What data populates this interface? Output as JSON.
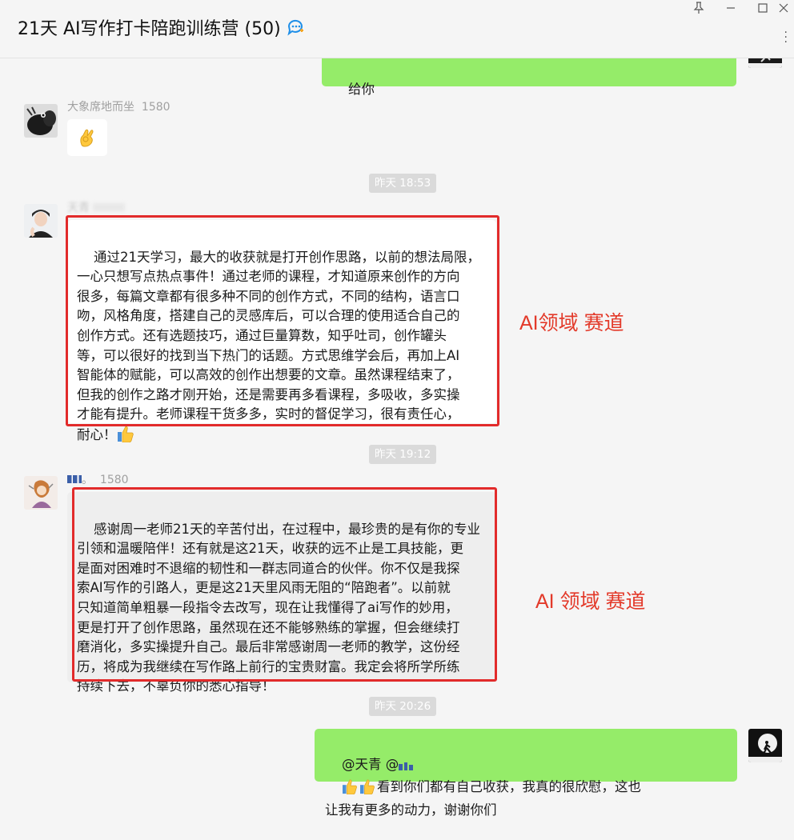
{
  "window": {
    "title": "21天 AI写作打卡陪跑训练营 (50)",
    "icon": "chat-bubble-icon",
    "controls": [
      "pin-icon",
      "minimize-icon",
      "maximize-icon",
      "close-icon",
      "more-icon"
    ]
  },
  "messages": {
    "m0": {
      "text": "给你",
      "side": "right",
      "avatar": "runner-moon-avatar"
    },
    "m1": {
      "sender": "大象席地而坐",
      "sender_tag": "1580",
      "content": "ok-hand-emoji"
    },
    "t1": "昨天 18:53",
    "m2": {
      "sender": "天青",
      "text": "通过21天学习，最大的收获就是打开创作思路，以前的想法局限，\n一心只想写点热点事件！通过老师的课程，才知道原来创作的方向\n很多，每篇文章都有很多种不同的创作方式，不同的结构，语言口\n吻，风格角度，搭建自己的灵感库后，可以合理的使用适合自己的\n创作方式。还有选题技巧，通过巨量算数，知乎吐司，创作罐头\n等，可以很好的找到当下热门的话题。方式思维学会后，再加上AI\n智能体的赋能，可以高效的创作出想要的文章。虽然课程结束了，\n但我的创作之路才刚开始，还是需要再多看课程，多吸收，多实操\n才能有提升。老师课程干货多多，实时的督促学习，很有责任心，\n耐心！",
      "trailing_emoji": "thumbs-up-emoji"
    },
    "t2": "昨天 19:12",
    "m3": {
      "sender": "。",
      "sender_tag": "1580",
      "text": "感谢周一老师21天的辛苦付出，在过程中，最珍贵的是有你的专业\n引领和温暖陪伴！还有就是这21天，收获的远不止是工具技能，更\n是面对困难时不退缩的韧性和一群志同道合的伙伴。你不仅是我探\n索AI写作的引路人，更是这21天里风雨无阻的“陪跑者”。以前就\n只知道简单粗暴一段指令去改写，现在让我懂得了ai写作的妙用，\n更是打开了创作思路，虽然现在还不能够熟练的掌握，但会继续打\n磨消化，多实操提升自己。最后非常感谢周一老师的教学，这份经\n历，将成为我继续在写作路上前行的宝贵财富。我定会将所学所练\n持续下去，不辜负你的悉心指导！"
    },
    "t3": "昨天 20:26",
    "m4": {
      "mention1": "@天青 @",
      "text_line1": "看到你们都有自己收获，我真的很欣慰，这也",
      "text_line2": "让我有更多的动力，谢谢你们"
    }
  },
  "annotations": {
    "a1": "AI领域 赛道",
    "a2": "AI 领域 赛道"
  },
  "colors": {
    "green_bubble": "#95ec69",
    "red_box": "#e22b2b",
    "annotation": "#e33a2a"
  }
}
